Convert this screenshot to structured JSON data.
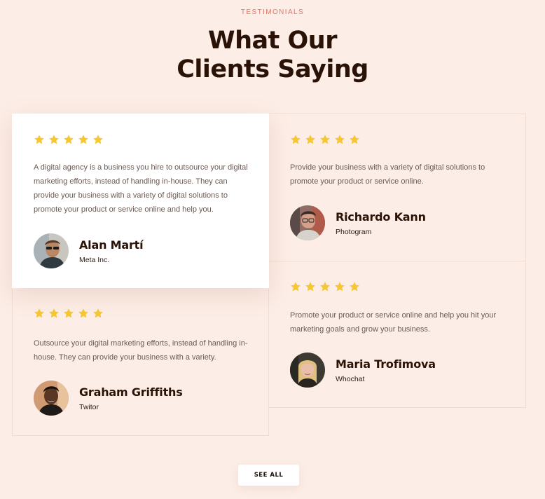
{
  "section": {
    "eyebrow": "TESTIMONIALS",
    "heading_line1": "What Our",
    "heading_line2": "Clients Saying",
    "see_all_label": "SEE ALL"
  },
  "colors": {
    "background": "#fcede6",
    "star": "#f5c731",
    "eyebrow": "#e0786a",
    "heading": "#2b1206"
  },
  "icons": {
    "rating": "star-icon"
  },
  "testimonials": [
    {
      "rating": 5,
      "quote": "A digital agency is a business you hire to outsource your digital marketing efforts, instead of handling in-house. They can provide your business with a variety of digital solutions to promote your product or service online and help you.",
      "name": "Alan Martí",
      "company": "Meta Inc."
    },
    {
      "rating": 5,
      "quote": "Provide your business with a variety of digital solutions to promote your product or service online.",
      "name": "Richardo Kann",
      "company": "Photogram"
    },
    {
      "rating": 5,
      "quote": "Outsource your digital marketing efforts, instead of handling in-house. They can provide your business with a variety.",
      "name": "Graham Griffiths",
      "company": "Twitor"
    },
    {
      "rating": 5,
      "quote": "Promote your product or service online and help you hit your marketing goals and grow your business.",
      "name": "Maria Trofimova",
      "company": "Whochat"
    }
  ]
}
